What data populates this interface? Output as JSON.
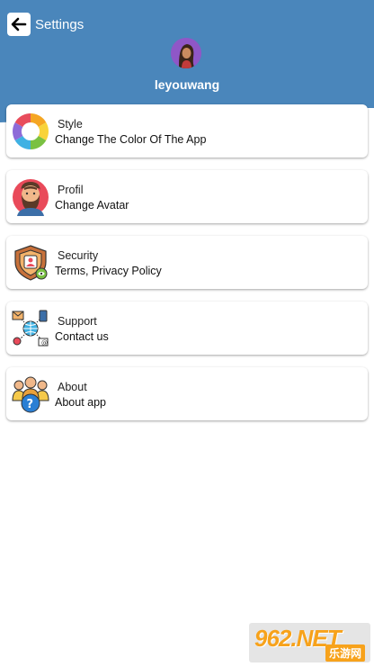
{
  "header": {
    "title": "Settings",
    "back_icon": "arrow-left-icon",
    "username": "leyouwang",
    "avatar_icon": "user-avatar-icon",
    "background_color": "#4a86bb"
  },
  "settings": {
    "items": [
      {
        "title": "Style",
        "subtitle": "Change The Color Of The App",
        "icon": "color-wheel-icon"
      },
      {
        "title": "Profil",
        "subtitle": "Change Avatar",
        "icon": "bearded-man-avatar-icon"
      },
      {
        "title": "Security",
        "subtitle": "Terms, Privacy Policy",
        "icon": "shield-user-icon"
      },
      {
        "title": "Support",
        "subtitle": "Contact us",
        "icon": "network-support-icon"
      },
      {
        "title": "About",
        "subtitle": "About app",
        "icon": "people-question-icon"
      }
    ]
  },
  "watermark": {
    "main": "962.NET",
    "sub": "乐游网"
  }
}
